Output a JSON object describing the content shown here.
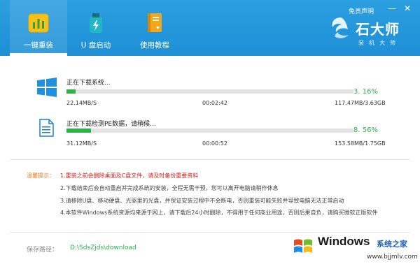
{
  "header": {
    "disclaimer": "免责声明",
    "min_glyph": "—",
    "close_glyph": "✕",
    "nav": [
      {
        "label": "一键重装",
        "icon": "bar-chart-icon"
      },
      {
        "label": "U 盘启动",
        "icon": "usb-drive-icon"
      },
      {
        "label": "使用教程",
        "icon": "book-icon"
      }
    ],
    "brand": {
      "name": "石大师",
      "sub": "装机大师"
    }
  },
  "downloads": [
    {
      "title": "正在下载系统...",
      "icon": "windows-logo-icon",
      "progress_percent": 3.16,
      "percent_text": "3. 16%",
      "speed": "22.14MB/S",
      "elapsed": "00:02:42",
      "size": "117.47MB/3.63GB"
    },
    {
      "title": "正在下载检测PE数据，请稍候...",
      "icon": "document-icon",
      "progress_percent": 8.56,
      "percent_text": "8. 56%",
      "speed": "31.12MB/S",
      "elapsed": "00:00:52",
      "size": "153.58MB/1.75GB"
    }
  ],
  "notes": {
    "label": "温馨提示：",
    "items": [
      "1.重装之前会删除桌面及C盘文件，请及时备份重要资料",
      "2.下载结束后会自动重启并完成系统的安装，全程无需干预，您可以离开电脑请稍作休息",
      "3.请移除U盘、移动硬盘、光驱里的光盘，并保证安装过程中不会断电，否则重装可能失败并导致电脑无法正常启动",
      "4.本软件Windows系统资源均来源于网上，请下载后24小时删除，不得用于任何商业用途，否则后果自负，请购买微软正版软件"
    ]
  },
  "save_path": {
    "label": "保存路径：",
    "value": "D:\\SdsZjds\\download"
  },
  "watermark": {
    "brand": "Windows",
    "cn": "系统之家",
    "url": "www.bjjmlv.com"
  },
  "colors": {
    "header_blue": "#1e8fd6",
    "progress_green": "#2db34a",
    "note_red": "#d61d1d",
    "label_orange": "#e87d1c"
  }
}
